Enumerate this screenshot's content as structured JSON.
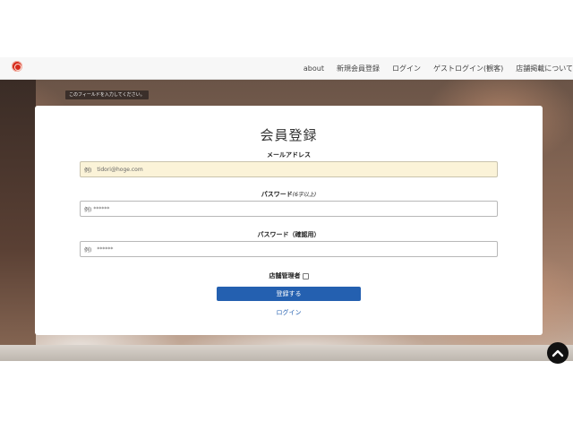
{
  "nav": {
    "links": [
      "about",
      "新規会員登録",
      "ログイン",
      "ゲストログイン(観客)",
      "店舗掲載について"
    ]
  },
  "tooltip": {
    "text": "このフィールドを入力してください。"
  },
  "form": {
    "title": "会員登録",
    "email_label": "メールアドレス",
    "email_prefix": "例)",
    "email_value": "tidori@hoge.com",
    "password_label": "パスワード",
    "password_note": "(6字以上)",
    "password_prefix": "例)",
    "password_value": "******",
    "password_confirm_label": "パスワード（確認用）",
    "password_confirm_prefix": "例)",
    "password_confirm_value": "******",
    "owner_label": "店舗管理者",
    "owner_checked": false,
    "submit_label": "登録する",
    "login_link": "ログイン"
  },
  "icons": {
    "logo": "logo-icon",
    "scroll_top": "chevron-up-icon"
  },
  "colors": {
    "primary": "#2460b0",
    "email_field_bg": "#fbf3d8",
    "logo": "#d62a1c"
  }
}
